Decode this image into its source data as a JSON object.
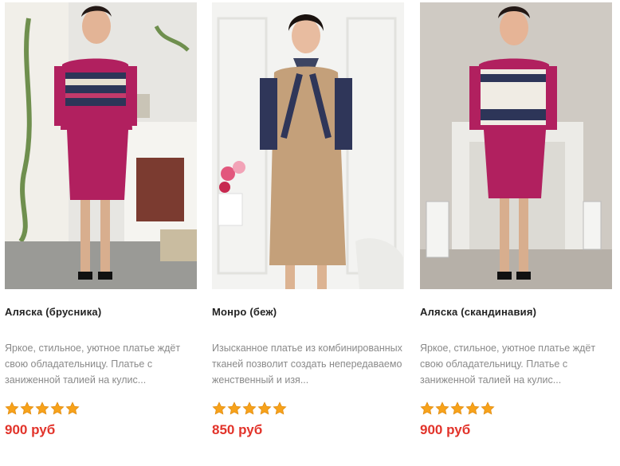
{
  "products": [
    {
      "title": "Аляска (брусника)",
      "description": "Яркое, стильное, уютное платье ждёт свою обладательницу. Платье с заниженной талией на кулис...",
      "rating": 5,
      "price": "900 руб",
      "image_alt": "Woman in raspberry knit dress with Nordic pattern yoke"
    },
    {
      "title": "Монро (беж)",
      "description": "Изысканное платье из комбинированных тканей позволит создать непередаваемо женственный и изя...",
      "rating": 5,
      "price": "850 руб",
      "image_alt": "Woman in beige dress with patterned sleeves and neck tie"
    },
    {
      "title": "Аляска (скандинавия)",
      "description": "Яркое, стильное, уютное платье ждёт свою обладательницу. Платье с заниженной талией на кулис...",
      "rating": 5,
      "price": "900 руб",
      "image_alt": "Woman in raspberry dress with Scandinavian pattern yoke"
    }
  ],
  "colors": {
    "title": "#222222",
    "description": "#8a8a8a",
    "price": "#e2332a",
    "star": "#f7a21b"
  },
  "icons": {
    "rating": "star-icon"
  }
}
